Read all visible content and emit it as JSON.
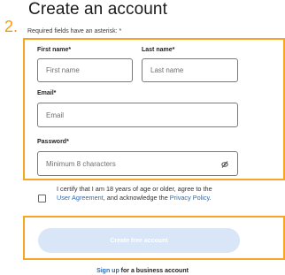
{
  "header": {
    "title": "Create an account",
    "step_number": "2.",
    "required_note": "Required fields have an asterisk: *"
  },
  "form": {
    "first_name": {
      "label": "First name*",
      "placeholder": "First name"
    },
    "last_name": {
      "label": "Last name*",
      "placeholder": "Last name"
    },
    "email": {
      "label": "Email*",
      "placeholder": "Email"
    },
    "password": {
      "label": "Password*",
      "placeholder": "Minimum 8 characters"
    }
  },
  "terms": {
    "line1": "I certify that I am 18 years of age or older, agree to the",
    "user_agreement": "User Agreement",
    "middle": ", and acknowledge the ",
    "privacy_policy": "Privacy Policy",
    "end": "."
  },
  "actions": {
    "create_button": "Create free account",
    "signup_link": "Sign up",
    "signup_suffix": " for a business account"
  },
  "colors": {
    "highlight": "#f6a623",
    "link": "#2b6bb3",
    "button_bg_disabled": "#d9e6f7"
  },
  "icons": {
    "password_toggle": "eye-slash-icon"
  }
}
